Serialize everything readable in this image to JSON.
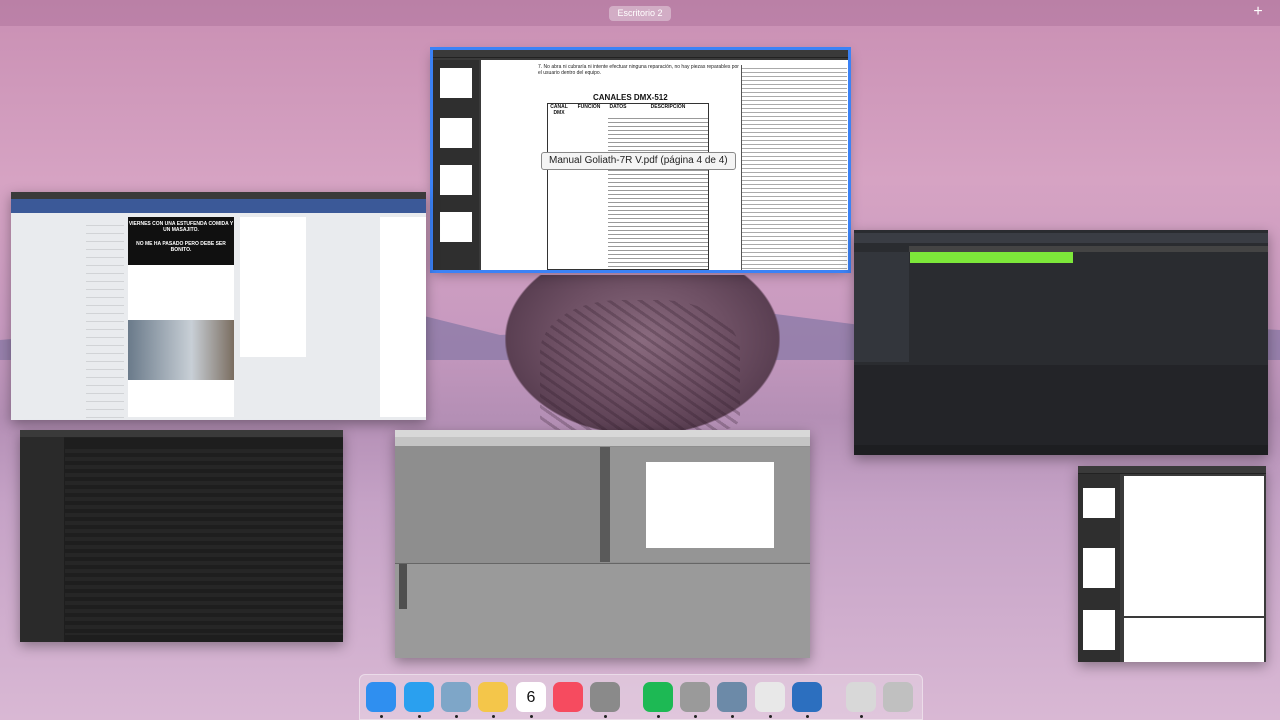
{
  "space": {
    "label": "Escritorio 2",
    "add_label": "+"
  },
  "pdf_window": {
    "tooltip": "Manual Goliath-7R V.pdf (página 4 de 4)",
    "page_title": "CANALES DMX-512",
    "note_line1": "7. No abra ni cubraría ni intente efectuar ninguna reparación, no hay piezas reparables por",
    "note_line2": "el usuario dentro del equipo.",
    "table_headers": [
      "CANAL DMX",
      "FUNCIÓN",
      "DATOS",
      "DESCRIPCIÓN"
    ]
  },
  "facebook_window": {
    "meme_line1": "VIERNES CON UNA ESTUFENDA COMIDA Y UN MASAJITO.",
    "meme_line2": "NO ME HA PASADO PERO DEBE SER BONITO."
  },
  "dock": {
    "items": [
      {
        "name": "finder-icon",
        "color": "#2f8ff0"
      },
      {
        "name": "safari-icon",
        "color": "#2aa0ef"
      },
      {
        "name": "preview-icon",
        "color": "#7ea6c8"
      },
      {
        "name": "photos-icon",
        "color": "#f4c64a"
      },
      {
        "name": "calendar-icon",
        "color": "#ffffff",
        "label": "6"
      },
      {
        "name": "music-icon",
        "color": "#f64b5f"
      },
      {
        "name": "system-preferences-icon",
        "color": "#8a8a8a"
      },
      {
        "name": "spotify-icon",
        "color": "#1db954"
      },
      {
        "name": "sunstar-icon",
        "color": "#9a9a9a"
      },
      {
        "name": "image-capture-icon",
        "color": "#6c8aa8"
      },
      {
        "name": "capcut-icon",
        "color": "#e8e8e8"
      },
      {
        "name": "quicktime-icon",
        "color": "#2c6fbf"
      },
      {
        "name": "scripts-icon",
        "color": "#d8d8d8"
      },
      {
        "name": "trash-icon",
        "color": "#c0c0c0"
      }
    ]
  }
}
